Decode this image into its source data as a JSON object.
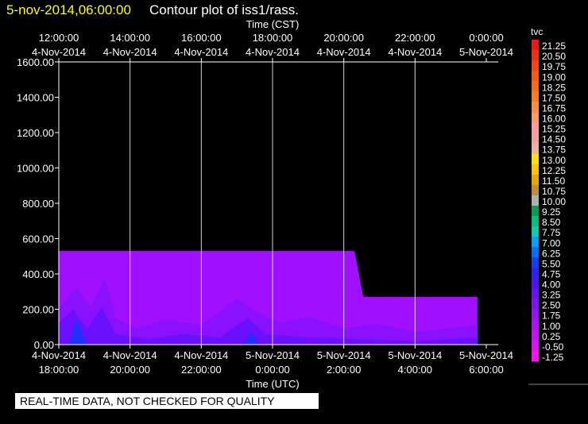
{
  "header": {
    "timestamp": "5-nov-2014,06:00:00",
    "title": "Contour plot of iss1/rass."
  },
  "banner": "REAL-TIME DATA, NOT CHECKED FOR QUALITY",
  "chart_data": {
    "type": "contour",
    "top_axis": {
      "label": "Time (CST)",
      "ticks": [
        {
          "time": "12:00:00",
          "date": "4-Nov-2014"
        },
        {
          "time": "14:00:00",
          "date": "4-Nov-2014"
        },
        {
          "time": "16:00:00",
          "date": "4-Nov-2014"
        },
        {
          "time": "18:00:00",
          "date": "4-Nov-2014"
        },
        {
          "time": "20:00:00",
          "date": "4-Nov-2014"
        },
        {
          "time": "22:00:00",
          "date": "4-Nov-2014"
        },
        {
          "time": "0:00:00",
          "date": "5-Nov-2014"
        }
      ]
    },
    "bottom_axis": {
      "label": "Time (UTC)",
      "ticks": [
        {
          "date": "4-Nov-2014",
          "time": "18:00:00"
        },
        {
          "date": "4-Nov-2014",
          "time": "20:00:00"
        },
        {
          "date": "4-Nov-2014",
          "time": "22:00:00"
        },
        {
          "date": "5-Nov-2014",
          "time": "0:00:00"
        },
        {
          "date": "5-Nov-2014",
          "time": "2:00:00"
        },
        {
          "date": "5-Nov-2014",
          "time": "4:00:00"
        },
        {
          "date": "5-Nov-2014",
          "time": "6:00:00"
        }
      ],
      "range_hours_from_first_tick": [
        0,
        12
      ]
    },
    "y_axis": {
      "ticks": [
        "0.00",
        "200.00",
        "400.00",
        "600.00",
        "800.00",
        "1000.00",
        "1200.00",
        "1400.00",
        "1600.00"
      ],
      "ylim": [
        0,
        1600
      ]
    },
    "grid": true,
    "colorbar": {
      "label": "tvc",
      "levels": [
        "21.25",
        "20.50",
        "19.75",
        "19.00",
        "18.25",
        "17.50",
        "16.75",
        "16.00",
        "15.25",
        "14.50",
        "13.75",
        "13.00",
        "12.25",
        "11.50",
        "10.75",
        "10.00",
        "9.25",
        "8.50",
        "7.75",
        "7.00",
        "6.25",
        "5.50",
        "4.75",
        "4.00",
        "3.25",
        "2.50",
        "1.75",
        "1.00",
        "0.25",
        "-0.50",
        "-1.25"
      ],
      "colors": [
        "#ff1010",
        "#ff2810",
        "#ff4010",
        "#ff5810",
        "#ff6a12",
        "#ff7c20",
        "#ff8c40",
        "#ff9a60",
        "#ff9a9a",
        "#f4a0a0",
        "#f0b0a0",
        "#ffe000",
        "#ffc400",
        "#e8a800",
        "#c09030",
        "#b0b0b0",
        "#00a050",
        "#00c080",
        "#00d0b0",
        "#00a0ff",
        "#0070ff",
        "#1040ff",
        "#3020ff",
        "#5010ff",
        "#6810ff",
        "#8010ff",
        "#9810ff",
        "#b010ff",
        "#c810ff",
        "#e010f8",
        "#ff10f0"
      ]
    },
    "contour_regions": [
      {
        "name": "background-field",
        "color": "#a010ff",
        "points": [
          [
            0,
            0
          ],
          [
            0,
            530
          ],
          [
            8.3,
            530
          ],
          [
            8.55,
            270
          ],
          [
            11.75,
            270
          ],
          [
            11.75,
            0
          ]
        ]
      },
      {
        "name": "darker-band",
        "color": "#8a10ff",
        "points": [
          [
            0,
            0
          ],
          [
            0,
            200
          ],
          [
            0.5,
            330
          ],
          [
            0.9,
            210
          ],
          [
            1.3,
            380
          ],
          [
            1.6,
            150
          ],
          [
            2.2,
            90
          ],
          [
            3,
            140
          ],
          [
            4,
            110
          ],
          [
            5,
            260
          ],
          [
            5.6,
            180
          ],
          [
            6.2,
            120
          ],
          [
            7,
            160
          ],
          [
            8,
            90
          ],
          [
            9,
            120
          ],
          [
            10,
            70
          ],
          [
            11.75,
            110
          ],
          [
            11.75,
            0
          ]
        ]
      },
      {
        "name": "deep-band",
        "color": "#6a10ff",
        "points": [
          [
            0,
            0
          ],
          [
            0,
            120
          ],
          [
            0.4,
            200
          ],
          [
            0.8,
            90
          ],
          [
            1.2,
            210
          ],
          [
            1.6,
            60
          ],
          [
            2.5,
            30
          ],
          [
            3.5,
            60
          ],
          [
            4.5,
            40
          ],
          [
            5.3,
            150
          ],
          [
            5.8,
            60
          ],
          [
            7,
            40
          ],
          [
            8.5,
            30
          ],
          [
            10,
            20
          ],
          [
            11.75,
            40
          ],
          [
            11.75,
            0
          ]
        ]
      },
      {
        "name": "blue-core-1",
        "color": "#2030ff",
        "points": [
          [
            0.3,
            0
          ],
          [
            0.5,
            150
          ],
          [
            0.8,
            0
          ]
        ]
      },
      {
        "name": "blue-core-2",
        "color": "#2030ff",
        "points": [
          [
            5.2,
            0
          ],
          [
            5.4,
            70
          ],
          [
            5.6,
            0
          ]
        ]
      }
    ]
  }
}
